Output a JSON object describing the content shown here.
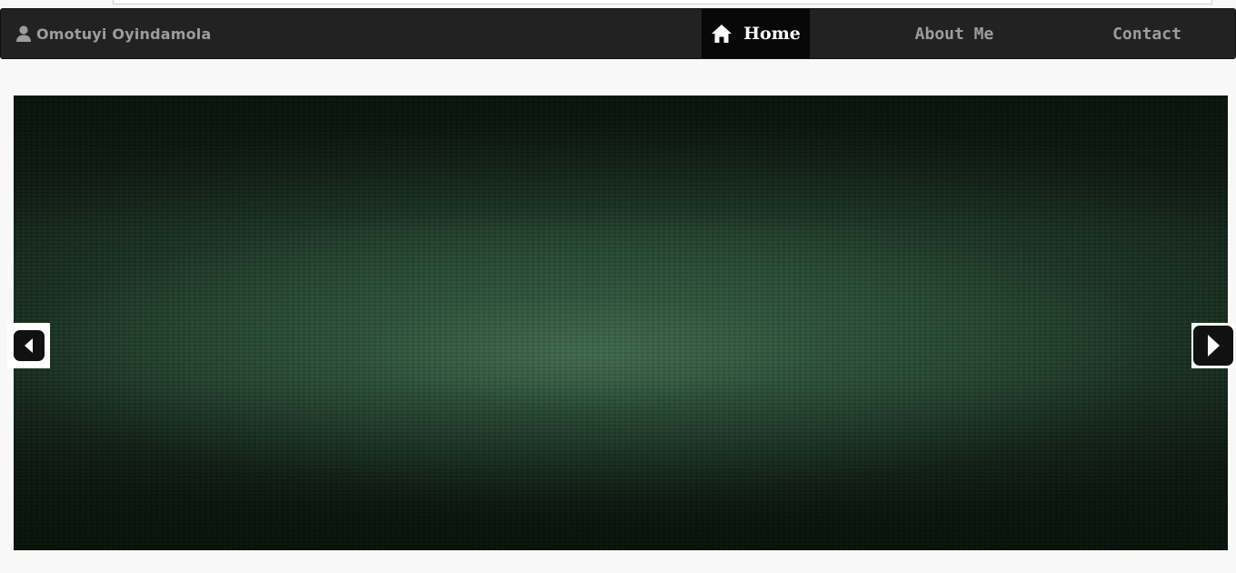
{
  "navbar": {
    "brand": {
      "icon": "user-icon",
      "name": "Omotuyi Oyindamola"
    },
    "items": [
      {
        "label": "Home",
        "icon": "home-icon",
        "active": true
      },
      {
        "label": "About Me",
        "active": false
      },
      {
        "label": "Contact",
        "active": false
      }
    ]
  },
  "carousel": {
    "prev_icon": "chevron-left-icon",
    "next_icon": "chevron-right-icon"
  },
  "colors": {
    "navbar_bg": "#222222",
    "active_nav_bg": "#080808",
    "nav_text": "#9d9d9d",
    "active_nav_text": "#ffffff",
    "page_bg": "#f8f8f8",
    "slide_green": "#2c5238"
  }
}
